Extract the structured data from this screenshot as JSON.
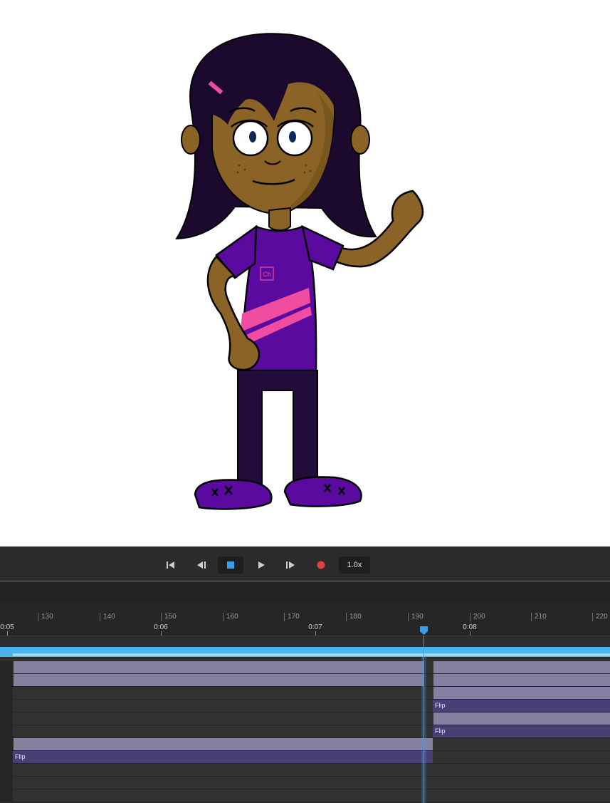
{
  "transport": {
    "speed_label": "1.0x",
    "icons": [
      "skip-to-start-icon",
      "step-back-icon",
      "stop-icon",
      "play-icon",
      "step-forward-icon",
      "record-icon"
    ],
    "colors": {
      "accent": "#3d8ed9",
      "record": "#e04040"
    }
  },
  "ruler": {
    "frame_ticks": [
      "130",
      "140",
      "150",
      "160",
      "170",
      "180",
      "190",
      "200",
      "210",
      "220"
    ],
    "time_ticks": [
      "0:05",
      "0:06",
      "0:07",
      "0:08"
    ]
  },
  "stage": {
    "badge": "Ch",
    "colors": {
      "hair": "#1c0a2e",
      "skin": "#8b6326",
      "shirt": "#5a0a9e",
      "stripe": "#f04ca0",
      "pants": "#220d3a",
      "shoes": "#5a0a9e"
    }
  },
  "tracks": {
    "flip_label": "Flip",
    "colors": {
      "bar_light": "#8580a0",
      "bar_dark": "#4a3f74",
      "range": "#4bb4ec"
    }
  }
}
